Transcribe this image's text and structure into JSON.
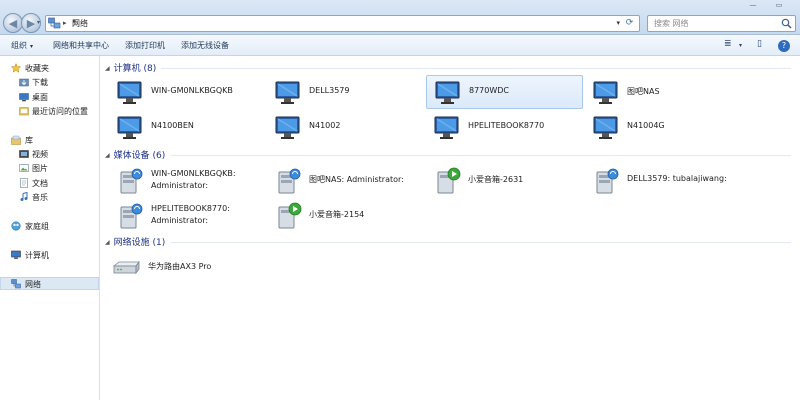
{
  "window": {
    "minimize_glyph": "—",
    "maximize_glyph": "▭"
  },
  "address": {
    "path_separator": "▸",
    "current": "网络",
    "separator_after": "▸",
    "dropdown_glyph": "▾",
    "refresh_glyph": "⟳"
  },
  "search": {
    "placeholder": "搜索 网络"
  },
  "nav_buttons": {
    "back": "◀",
    "forward": "▶",
    "recent": "▾"
  },
  "toolbar": {
    "organize": "组织",
    "organize_caret": "▾",
    "network_center": "网络和共享中心",
    "add_printer": "添加打印机",
    "add_wireless": "添加无线设备",
    "view_glyph": "≣",
    "view_caret": "▾",
    "pane_glyph": "▯",
    "help_glyph": "?"
  },
  "navpane": {
    "favorites": "收藏夹",
    "downloads": "下载",
    "desktop": "桌面",
    "recent": "最近访问的位置",
    "libraries": "库",
    "videos": "视频",
    "pictures": "图片",
    "documents": "文档",
    "music": "音乐",
    "homegroup": "家庭组",
    "computer": "计算机",
    "network": "网络"
  },
  "groups": {
    "computers": {
      "caret": "◢",
      "title": "计算机 (8)",
      "items": [
        "WIN-GM0NLKBGQKB",
        "DELL3579",
        "8770WDC",
        "图吧NAS",
        "N4100BEN",
        "N41002",
        "HPELITEBOOK8770",
        "N41004G"
      ]
    },
    "media": {
      "caret": "◢",
      "title": "媒体设备 (6)",
      "items": [
        {
          "line1": "WIN-GM0NLKBGQKB:",
          "line2": "Administrator:"
        },
        {
          "line1": "图吧NAS: Administrator:",
          "line2": ""
        },
        {
          "line1": "小爱音箱-2631",
          "line2": ""
        },
        {
          "line1": "DELL3579: tubalajiwang:",
          "line2": ""
        },
        {
          "line1": "HPELITEBOOK8770:",
          "line2": "Administrator:"
        },
        {
          "line1": "小爱音箱-2154",
          "line2": ""
        }
      ]
    },
    "infrastructure": {
      "caret": "◢",
      "title": "网络设施 (1)",
      "items": [
        "华为路由AX3 Pro"
      ]
    }
  },
  "colors": {
    "accent": "#3b6ea8",
    "header_text": "#1e3287",
    "selection": "#dbe9fa"
  }
}
